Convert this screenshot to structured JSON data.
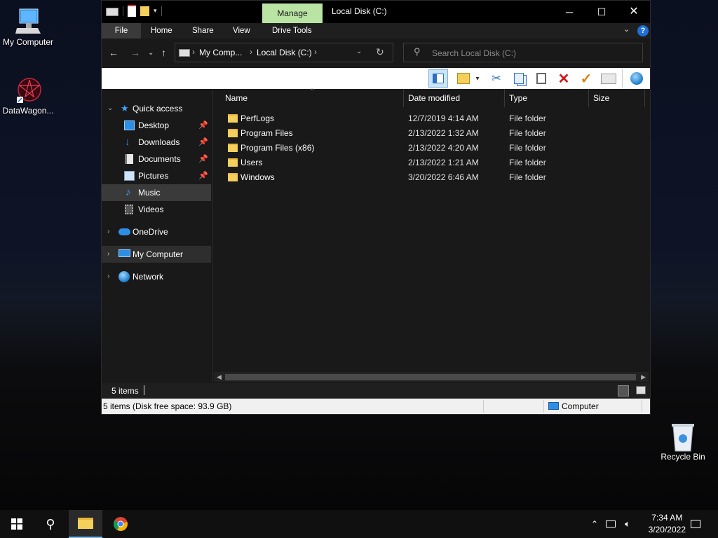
{
  "desktop": {
    "icons": [
      {
        "label": "My Computer"
      },
      {
        "label": "DataWagon..."
      },
      {
        "label": "Recycle Bin"
      }
    ]
  },
  "window": {
    "context_tab": "Manage",
    "title": "Local Disk (C:)",
    "ribbon_tabs": [
      "File",
      "Home",
      "Share",
      "View",
      "Drive Tools"
    ],
    "address": {
      "crumbs": [
        "My Comp...",
        "Local Disk (C:)"
      ]
    },
    "search_placeholder": "Search Local Disk (C:)",
    "nav": {
      "quick_access": "Quick access",
      "items": [
        {
          "label": "Desktop",
          "pinned": true
        },
        {
          "label": "Downloads",
          "pinned": true
        },
        {
          "label": "Documents",
          "pinned": true
        },
        {
          "label": "Pictures",
          "pinned": true
        },
        {
          "label": "Music",
          "pinned": false
        },
        {
          "label": "Videos",
          "pinned": false
        }
      ],
      "onedrive": "OneDrive",
      "my_computer": "My Computer",
      "network": "Network"
    },
    "columns": {
      "name": "Name",
      "date": "Date modified",
      "type": "Type",
      "size": "Size"
    },
    "files": [
      {
        "name": "PerfLogs",
        "date": "12/7/2019 4:14 AM",
        "type": "File folder"
      },
      {
        "name": "Program Files",
        "date": "2/13/2022 1:32 AM",
        "type": "File folder"
      },
      {
        "name": "Program Files (x86)",
        "date": "2/13/2022 4:20 AM",
        "type": "File folder"
      },
      {
        "name": "Users",
        "date": "2/13/2022 1:21 AM",
        "type": "File folder"
      },
      {
        "name": "Windows",
        "date": "3/20/2022 6:46 AM",
        "type": "File folder"
      }
    ],
    "status": {
      "count": "5 items"
    },
    "bottom": {
      "info": "5 items (Disk free space: 93.9 GB)",
      "location": "Computer"
    }
  },
  "taskbar": {
    "time": "7:34 AM",
    "date": "3/20/2022"
  },
  "colors": {
    "manage_tab": "#b9e4a4",
    "folder": "#f4cf5c",
    "accent": "#1e90ff"
  }
}
